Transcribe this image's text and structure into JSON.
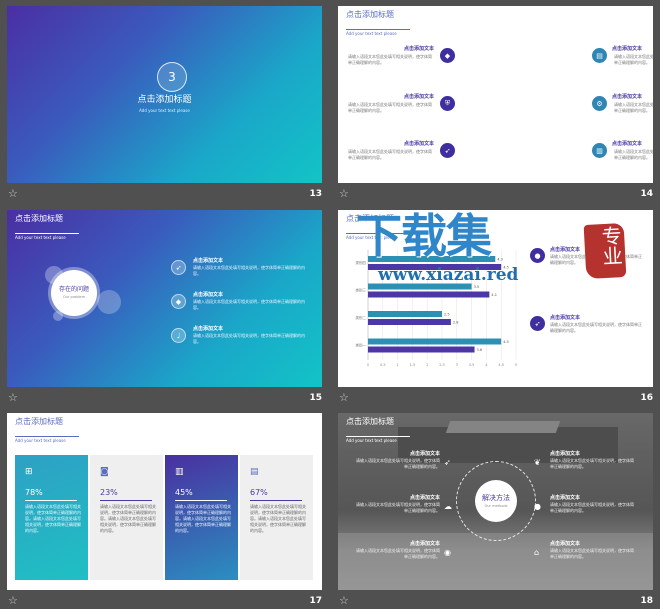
{
  "block_title": "点击添加文本",
  "block_text": "请输入语段文本您此处填写相关说明，使字体简单正确理解的内容。",
  "header_title": "点击添加标题",
  "header_sub": "Add your text text please",
  "s13": {
    "number": "3",
    "title": "点击添加标题",
    "sub": "Add your text text please",
    "page": "13"
  },
  "s14": {
    "page": "14",
    "icons": [
      "tag-icon",
      "document-icon",
      "shield-icon",
      "gear-icon",
      "rocket-icon",
      "trash-icon"
    ]
  },
  "s15": {
    "circle_title": "存在的问题",
    "circle_sub": "Our problem",
    "page": "15",
    "icons": [
      "rocket-icon",
      "tag-icon",
      "microphone-icon"
    ]
  },
  "s16": {
    "page": "16",
    "watermark_main": "下载集",
    "watermark_url": "www.xiazai.red",
    "watermark_seal": "专业"
  },
  "chart_data": {
    "type": "bar",
    "orientation": "horizontal",
    "categories": [
      "类别四",
      "类别三",
      "类别二",
      "类别一"
    ],
    "series": [
      {
        "values": [
          4.3,
          3.5,
          2.5,
          4.5
        ],
        "color": "#2e8fb5"
      },
      {
        "values": [
          4.5,
          4.1,
          2.8,
          3.6
        ],
        "color": "#4b38a6"
      }
    ],
    "xlim": [
      0,
      5
    ],
    "xticks": [
      "0",
      "0.5",
      "1",
      "1.5",
      "2",
      "2.5",
      "3",
      "3.5",
      "4",
      "4.5",
      "5"
    ],
    "grid": true
  },
  "s17": {
    "page": "17",
    "cards": [
      {
        "icon": "cart-icon",
        "percent": "78%",
        "text": "请输入语段文本您此处填写相关说明，使字体简单正确理解的内容。请输入语段文本您此处填写相关说明，使字体简单正确理解的内容。"
      },
      {
        "icon": "camera-icon",
        "percent": "23%",
        "text": "请输入语段文本您此处填写相关说明，使字体简单正确理解的内容。请输入语段文本您此处填写相关说明，使字体简单正确理解的内容。"
      },
      {
        "icon": "bar-chart-icon",
        "percent": "45%",
        "text": "请输入语段文本您此处填写相关说明，使字体简单正确理解的内容。请输入语段文本您此处填写相关说明，使字体简单正确理解的内容。"
      },
      {
        "icon": "document-icon",
        "percent": "67%",
        "text": "请输入语段文本您此处填写相关说明，使字体简单正确理解的内容。请输入语段文本您此处填写相关说明，使字体简单正确理解的内容。"
      }
    ]
  },
  "s18": {
    "center": "解决方法",
    "center_sub": "Our methods",
    "page": "18"
  }
}
